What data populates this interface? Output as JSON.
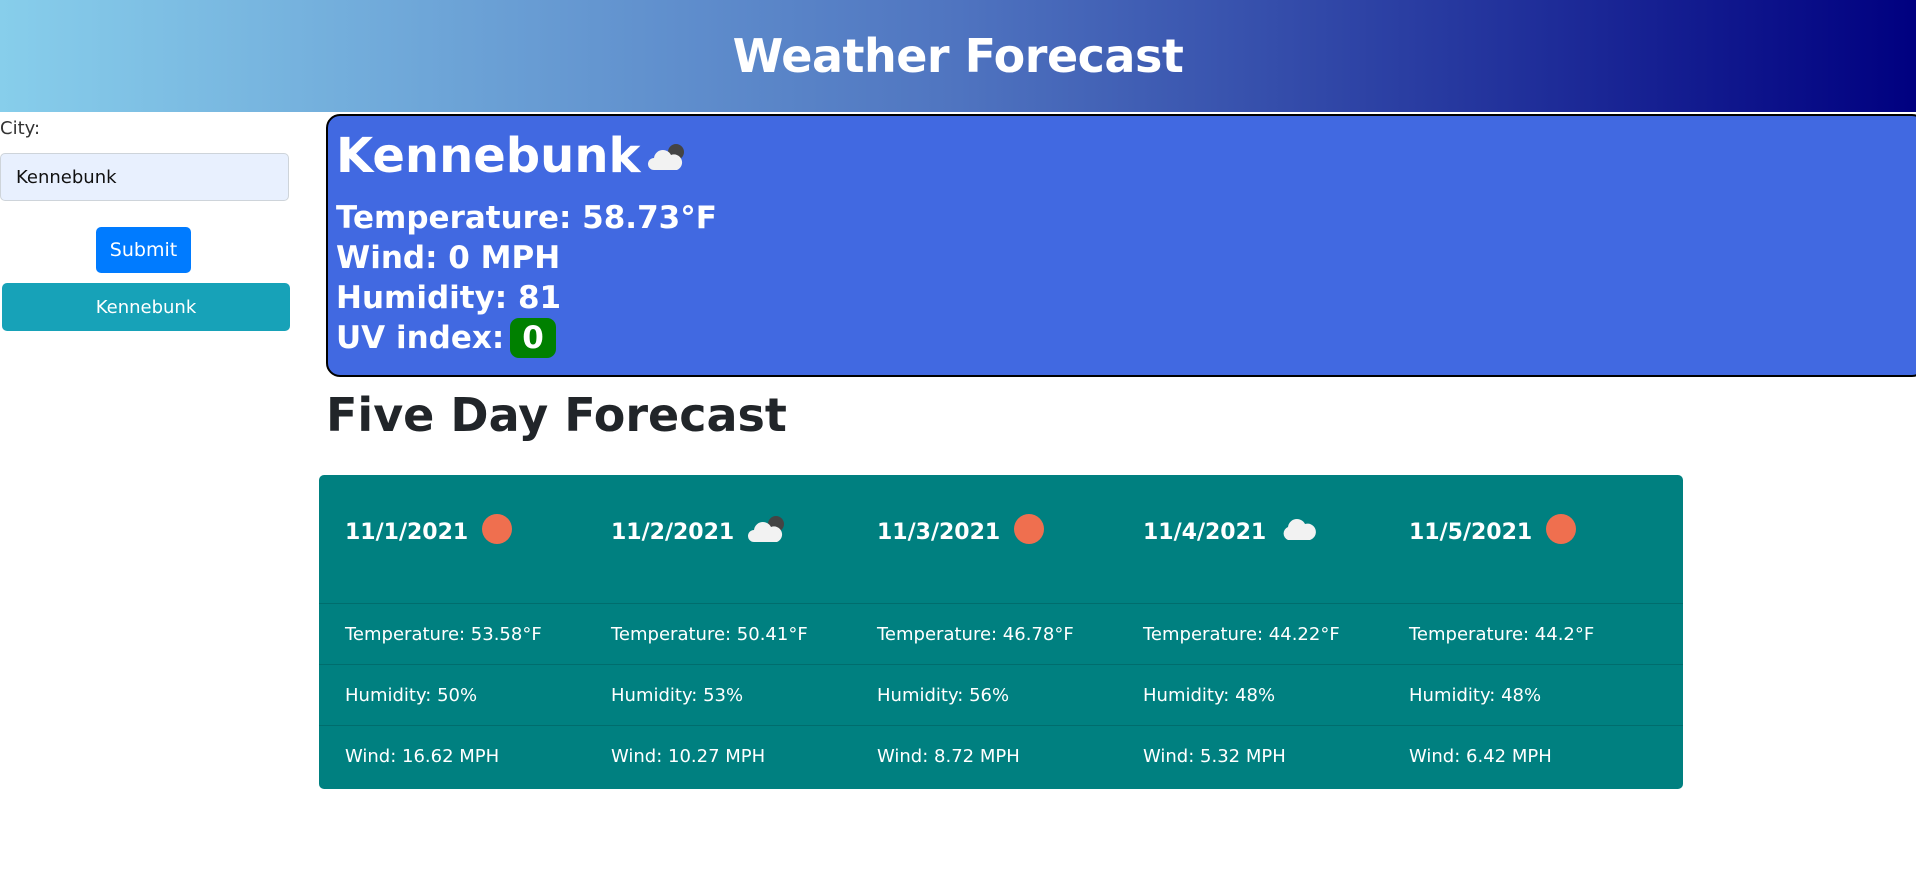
{
  "header": {
    "title": "Weather Forecast"
  },
  "sidebar": {
    "city_label": "City:",
    "city_value": "Kennebunk",
    "submit_label": "Submit",
    "history": [
      "Kennebunk"
    ]
  },
  "current": {
    "city": "Kennebunk",
    "icon": "cloud-dark-icon",
    "temperature": "Temperature: 58.73°F",
    "wind": "Wind: 0 MPH",
    "humidity": "Humidity: 81",
    "uv_label": "UV index:",
    "uv_value": "0",
    "uv_color": "#008000"
  },
  "forecast": {
    "title": "Five Day Forecast",
    "days": [
      {
        "date": "11/1/2021",
        "icon": "sun-icon",
        "temp": "Temperature: 53.58°F",
        "humidity": "Humidity: 50%",
        "wind": "Wind: 16.62 MPH"
      },
      {
        "date": "11/2/2021",
        "icon": "cloud-dark-icon",
        "temp": "Temperature: 50.41°F",
        "humidity": "Humidity: 53%",
        "wind": "Wind: 10.27 MPH"
      },
      {
        "date": "11/3/2021",
        "icon": "sun-icon",
        "temp": "Temperature: 46.78°F",
        "humidity": "Humidity: 56%",
        "wind": "Wind: 8.72 MPH"
      },
      {
        "date": "11/4/2021",
        "icon": "cloud-icon",
        "temp": "Temperature: 44.22°F",
        "humidity": "Humidity: 48%",
        "wind": "Wind: 5.32 MPH"
      },
      {
        "date": "11/5/2021",
        "icon": "sun-icon",
        "temp": "Temperature: 44.2°F",
        "humidity": "Humidity: 48%",
        "wind": "Wind: 6.42 MPH"
      }
    ]
  }
}
